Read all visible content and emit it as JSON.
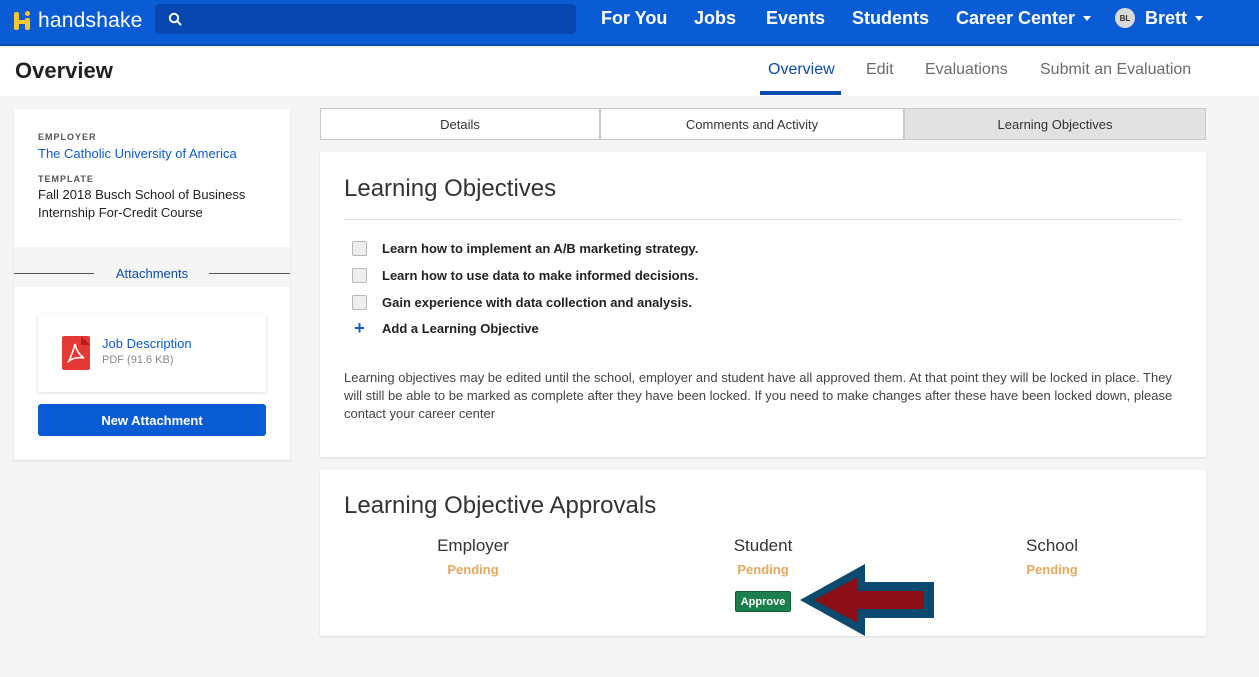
{
  "app": {
    "brand": "handshake"
  },
  "nav": {
    "items": [
      "For You",
      "Jobs",
      "Events",
      "Students",
      "Career Center"
    ],
    "user": {
      "initials": "BL",
      "name": "Brett"
    }
  },
  "page": {
    "title": "Overview",
    "tabs": [
      "Overview",
      "Edit",
      "Evaluations",
      "Submit an Evaluation"
    ],
    "active_tab": "Overview"
  },
  "sidebar": {
    "employer_label": "EMPLOYER",
    "employer": "The Catholic University of America",
    "template_label": "TEMPLATE",
    "template_line1": "Fall 2018 Busch School of Business",
    "template_line2": "Internship For-Credit Course",
    "attachments_title": "Attachments",
    "attachment": {
      "name": "Job Description",
      "meta": "PDF (91.6 KB)",
      "icon": "pdf-icon"
    },
    "new_attachment": "New Attachment"
  },
  "detail_tabs": [
    "Details",
    "Comments and Activity",
    "Learning Objectives"
  ],
  "objectives": {
    "title": "Learning Objectives",
    "items": [
      "Learn how to implement an A/B marketing strategy.",
      "Learn how to use data to make informed decisions.",
      "Gain experience with data collection and analysis."
    ],
    "add_label": "Add a Learning Objective",
    "note": "Learning objectives may be edited until the school, employer and student have all approved them. At that point they will be locked in place. They will still be able to be marked as complete after they have been locked. If you need to make changes after these have been locked down, please contact your career center"
  },
  "approvals": {
    "title": "Learning Objective Approvals",
    "parties": [
      {
        "name": "Employer",
        "status": "Pending"
      },
      {
        "name": "Student",
        "status": "Pending"
      },
      {
        "name": "School",
        "status": "Pending"
      }
    ],
    "approve_label": "Approve"
  },
  "colors": {
    "brand_blue": "#0a5cd5",
    "pending": "#e8a75a",
    "approve_green": "#1a7f4b",
    "arrow_fill": "#8b0f14",
    "arrow_outline": "#0b4a6e"
  }
}
